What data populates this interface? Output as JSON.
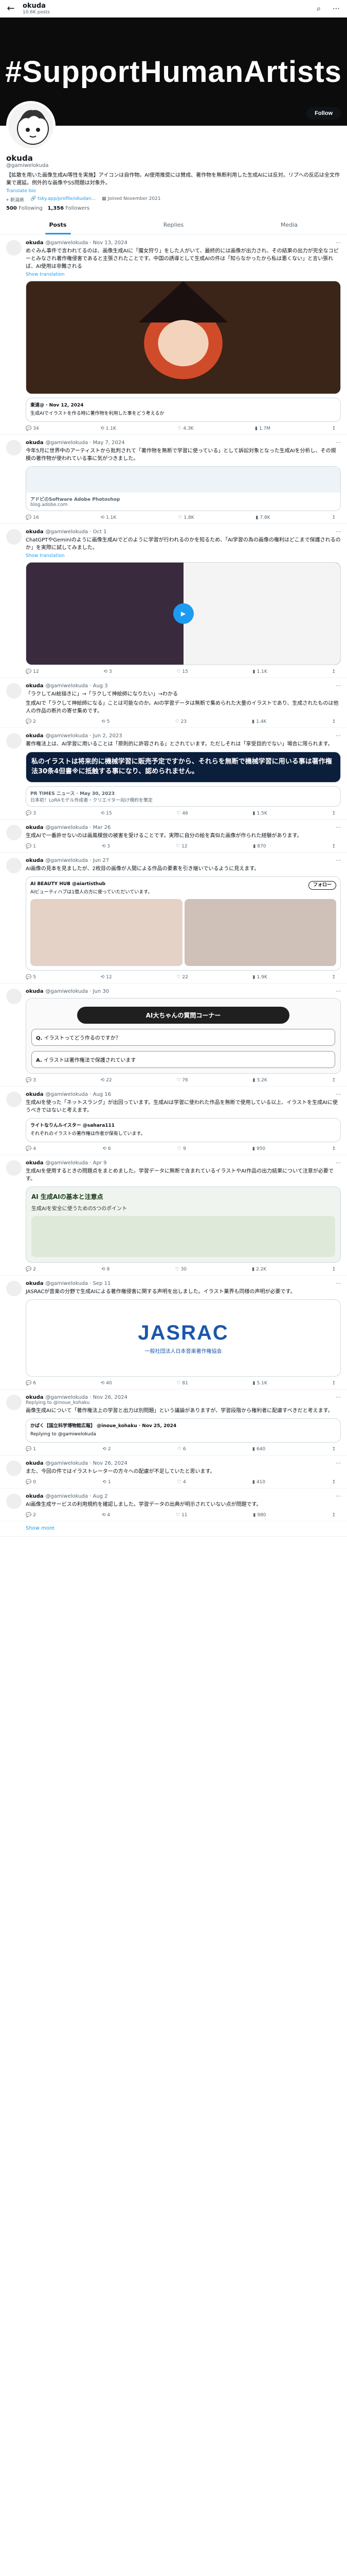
{
  "topbar": {
    "name": "okuda",
    "posts_count": "10.6K posts"
  },
  "banner": {
    "text": "#SupportHumanArtists"
  },
  "profile": {
    "follow_label": "Follow",
    "name": "okuda",
    "handle": "@gamiwelokuda",
    "bio": "【拡散を用いた画像生成AI等性を実施】アイコンは自作物。AI使用推奨には賛成、著作物を無断利用した生成AIには反対。リプへの反応は全文作業で遅延。例外的な画像やSS問題は対象外。",
    "translate": "Translate bio",
    "location": "新潟県",
    "link": "tsky.app/profile/okudan...",
    "joined": "Joined November 2021",
    "following_count": "500",
    "following_label": "Following",
    "followers_count": "1,356",
    "followers_label": "Followers"
  },
  "tabs": [
    "Posts",
    "Replies",
    "Media"
  ],
  "posts": [
    {
      "name": "okuda",
      "handle": "@gamiwelokuda · Nov 13, 2024",
      "text": "めぐみん事件で言われてるのは、画像生成AIに「魔女狩り」をした人がいて、最終的には画像が出力され、その結果の出力が完全なコピーとみなされ著作権侵害であると主張されたことです。中国の誘導として生成AIの件は「知らなかったから私は悪くない」と言い張れば、AI使用は非難される",
      "translate": "Show translation",
      "quote_head": "東道@ · Nov 12, 2024",
      "quote_text": "生成AIでイラストを作る時に著作物を利用した事をどう考えるか",
      "stats": [
        "34",
        "1.1K",
        "4.3K",
        "1.7M"
      ]
    },
    {
      "name": "okuda",
      "handle": "@gamiwelokuda · May 7, 2024",
      "text": "今年5月に世界中のアーティストから批判されて「著作物を無断で学習に使っている」として訴訟対象となった生成AIを分析し、その規模の著作物が使われている事に気がつきました。",
      "link_title": "アドビのSoftware Adobe Photoshop",
      "link_domain": "blog.adobe.com",
      "stats": [
        "16",
        "1.1K",
        "1.8K",
        "7.8K"
      ]
    },
    {
      "name": "okuda",
      "handle": "@gamiwelokuda · Oct 1",
      "text": "ChatGPTやGeminiのように画像生成AIでどのように学習が行われるのかを知るため、「AI学習の為の画像の権利はどこまで保護されるのか」を実際に試してみました。",
      "translate": "Show translation",
      "stats": [
        "12",
        "3",
        "15",
        "1.1K"
      ]
    },
    {
      "name": "okuda",
      "handle": "@gamiwelokuda · Aug 3",
      "text": "「ラクしてAI絵描きに」→「ラクして神絵師になりたい」→わかる",
      "text2": "生成AIで「ラクして神絵師になる」ことは可能なのか。AIの学習データは無断で集められた大量のイラストであり、生成されたものは他人の作品の断片の寄せ集めです。",
      "stats": [
        "2",
        "5",
        "23",
        "1.4K"
      ]
    },
    {
      "name": "okuda",
      "handle": "@gamiwelokuda · Jun 2, 2023",
      "text": "著作権法上は、AI学習に用いることは「原則的に許容される」とされています。ただしそれは「享受目的でない」場合に限られます。",
      "headline": "私のイラストは将来的に機械学習に販売予定ですから、それらを無断で機械学習に用いる事は著作権法30条4但書※に抵触する事になり、認められません。",
      "link_title": "PR TIMES ニュース · May 30, 2023",
      "link_text": "日本初！LoRAモデル作成者・クリエイター向け規約を策定",
      "stats": [
        "3",
        "15",
        "46",
        "1.5K"
      ]
    },
    {
      "name": "okuda",
      "handle": "@gamiwelokuda · Mar 26",
      "text": "生成AIで一番許せないのは画風模倣の被害を受けることです。実際に自分の絵を真似た画像が作られた経験があります。",
      "stats": [
        "1",
        "3",
        "12",
        "870"
      ]
    },
    {
      "name": "okuda",
      "handle": "@gamiwelokuda · Jun 27",
      "text": "AI画像の見本を見ましたが、2枚目の画像が人間による作品の要素を引き継いでいるように見えます。",
      "quote_head": "AI BEAUTY HUB @aiartisthub",
      "quote_text": "AIビューティハブは1億人の方に使っていただいています。",
      "follow": "フォロー",
      "stats": [
        "5",
        "12",
        "22",
        "1.9K"
      ]
    },
    {
      "name": "okuda",
      "handle": "@gamiwelokuda · Jun 30",
      "text": "",
      "card_title": "AI大ちゃんの質問コーナー",
      "q_label": "Q.",
      "q_text": "イラストってどう作るのですか？",
      "a_label": "A.",
      "a_text": "イラストは著作権法で保護されています",
      "stats": [
        "3",
        "22",
        "76",
        "3.2K"
      ]
    },
    {
      "name": "okuda",
      "handle": "@gamiwelokuda · Aug 16",
      "text": "生成AIを使った「ネットスラング」が出回っています。生成AIは学習に使われた作品を無断で使用している以上、イラストを生成AIに使うべきではないと考えます。",
      "quote_head": "ライトなりんルイスター @sahara111",
      "quote_text": "それぞれのイラストの著作権は作者が保有しています。",
      "stats": [
        "4",
        "6",
        "9",
        "950"
      ]
    },
    {
      "name": "okuda",
      "handle": "@gamiwelokuda · Apr 9",
      "text": "生成AIを使用するときの問題点をまとめました。学習データに無断で含まれているイラストやAI作品の出力結果について注意が必要です。",
      "card_head": "AI 生成AIの基本と注意点",
      "card_line": "生成AIを安全に使うための5つのポイント",
      "stats": [
        "2",
        "8",
        "30",
        "2.2K"
      ]
    },
    {
      "name": "okuda",
      "handle": "@gamiwelokuda · Sep 11",
      "text": "JASRACが音楽の分野で生成AIによる著作権侵害に関する声明を出しました。イラスト業界も同様の声明が必要です。",
      "card_logo": "JASRAC",
      "card_sub": "一般社団法人日本音楽著作権協会",
      "stats": [
        "6",
        "40",
        "81",
        "5.1K"
      ]
    },
    {
      "name": "okuda",
      "handle": "@gamiwelokuda · Nov 26, 2024",
      "reply": "Replying to @inoue_kohaku",
      "text": "画像生成AIについて「著作権法上の学習と出力は別問題」という議論がありますが、学習段階から権利者に配慮すべきだと考えます。",
      "quote_head": "かばく【国立科学博物館広報】 @inoue_kohaku · Nov 25, 2024",
      "quote_text": "Replying to @gamiwelokuda",
      "stats": [
        "1",
        "2",
        "6",
        "640"
      ]
    },
    {
      "name": "okuda",
      "handle": "@gamiwelokuda · Nov 26, 2024",
      "text": "また、今回の件ではイラストレーターの方々への配慮が不足していたと思います。",
      "stats": [
        "0",
        "1",
        "4",
        "410"
      ]
    },
    {
      "name": "okuda",
      "handle": "@gamiwelokuda · Aug 2",
      "text": "AI画像生成サービスの利用規約を確認しました。学習データの出典が明示されていない点が問題です。",
      "stats": [
        "2",
        "4",
        "11",
        "980"
      ]
    }
  ],
  "show_more": "Show more"
}
